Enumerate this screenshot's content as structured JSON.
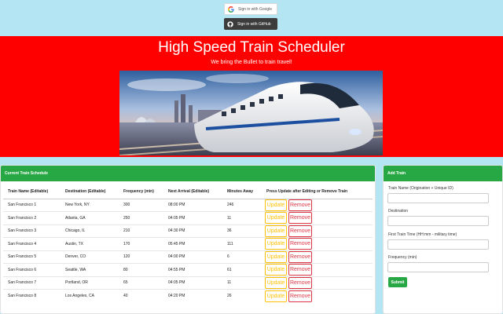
{
  "auth": {
    "google_label": "Sign in with Google",
    "github_label": "Sign in with GitHub"
  },
  "hero": {
    "title": "High Speed Train Scheduler",
    "subtitle": "We bring the Bullet to train travel!"
  },
  "schedule": {
    "header": "Current Train Schedule",
    "columns": [
      "Train Name (Editable)",
      "Destination (Editable)",
      "Frequency (min)",
      "Next Arrival (Editable)",
      "Minutes Away",
      "Press Update after Editing or Remove Train"
    ],
    "update_label": "Update",
    "remove_label": "Remove",
    "rows": [
      {
        "name": "San Francisco 1",
        "destination": "New York, NY",
        "frequency": "300",
        "next_arrival": "08:00 PM",
        "minutes_away": "246"
      },
      {
        "name": "San Francisco 2",
        "destination": "Atlanta, GA",
        "frequency": "250",
        "next_arrival": "04:05 PM",
        "minutes_away": "11"
      },
      {
        "name": "San Francisco 3",
        "destination": "Chicago, IL",
        "frequency": "210",
        "next_arrival": "04:30 PM",
        "minutes_away": "36"
      },
      {
        "name": "San Francisco 4",
        "destination": "Austin, TX",
        "frequency": "170",
        "next_arrival": "05:45 PM",
        "minutes_away": "111"
      },
      {
        "name": "San Francisco 5",
        "destination": "Denver, CO",
        "frequency": "120",
        "next_arrival": "04:00 PM",
        "minutes_away": "6"
      },
      {
        "name": "San Francisco 6",
        "destination": "Seattle, WA",
        "frequency": "80",
        "next_arrival": "04:55 PM",
        "minutes_away": "61"
      },
      {
        "name": "San Francisco 7",
        "destination": "Portland, OR",
        "frequency": "65",
        "next_arrival": "04:05 PM",
        "minutes_away": "11"
      },
      {
        "name": "San Francisco 8",
        "destination": "Los Angeles, CA",
        "frequency": "40",
        "next_arrival": "04:20 PM",
        "minutes_away": "26"
      }
    ]
  },
  "add_train": {
    "header": "Add Train",
    "name_label": "Train Name (Origination + Unique ID)",
    "destination_label": "Destination",
    "first_time_label": "First Train Time (HH:mm - military time)",
    "frequency_label": "Frequency (min)",
    "submit_label": "Submit"
  },
  "colors": {
    "page_bg": "#b3e6f2",
    "hero_bg": "#ff0000",
    "panel_header": "#28a745",
    "update": "#ffc107",
    "remove": "#dc3545"
  }
}
